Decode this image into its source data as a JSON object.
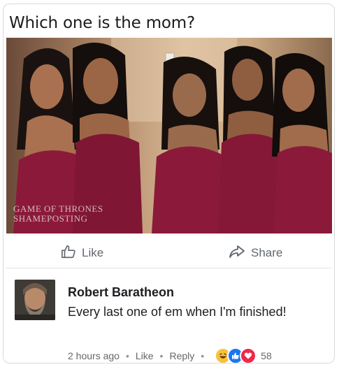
{
  "post": {
    "title": "Which one is the mom?",
    "watermark": "GAME OF THRONES SHAMEPOSTING"
  },
  "actions": {
    "like_label": "Like",
    "share_label": "Share"
  },
  "comment": {
    "author": "Robert Baratheon",
    "text": "Every last one of em when I'm finished!",
    "time": "2 hours ago",
    "like_label": "Like",
    "reply_label": "Reply",
    "reactions": [
      "haha-icon",
      "like-icon",
      "love-icon"
    ],
    "reaction_count": "58"
  },
  "colors": {
    "dress": "#8b1a3a",
    "like_blue": "#1877f2",
    "love_red": "#f0284a",
    "haha_yellow": "#f7c23b"
  }
}
